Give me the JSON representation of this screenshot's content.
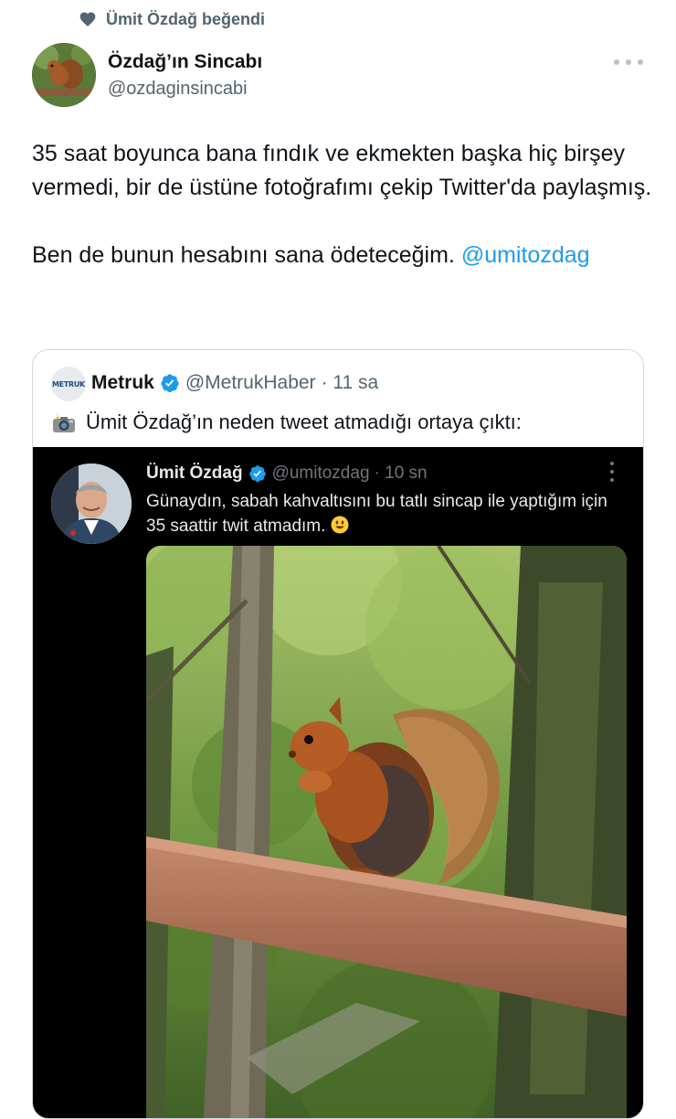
{
  "social_context": {
    "text": "Ümit Özdağ beğendi",
    "icon": "heart-icon"
  },
  "tweet": {
    "author_name": "Özdağ’ın Sincabı",
    "author_handle": "@ozdaginsincabi",
    "text_line1": "35 saat boyunca bana fındık ve ekmekten başka hiç birşey vermedi, bir de üstüne fotoğrafımı çekip Twitter'da paylaşmış.",
    "text_line2_prefix": "Ben de bunun hesabını sana ödeteceğim. ",
    "mention": "@umitozdag",
    "more_icon": "more-horizontal-icon"
  },
  "quote": {
    "logo_text": "METRUK",
    "author_name": "Metruk",
    "author_handle": "@MetrukHaber",
    "time": "· 11 sa",
    "text": "Ümit Özdağ’ın neden tweet atmadığı ortaya çıktı:",
    "text_icon": "camera-flash-icon",
    "screenshot": {
      "author_name": "Ümit Özdağ",
      "author_handle": "@umitozdag",
      "time": "· 10 sn",
      "text": "Günaydın, sabah kahvaltısını bu tatlı sincap ile yaptığım için 35 saattir twit atmadım.",
      "emoji": "smiley-icon",
      "more_icon": "more-vertical-icon"
    }
  },
  "colors": {
    "link": "#1d9bf0",
    "muted": "#536471",
    "verified": "#1d9bf0",
    "dark_bg": "#000000"
  }
}
